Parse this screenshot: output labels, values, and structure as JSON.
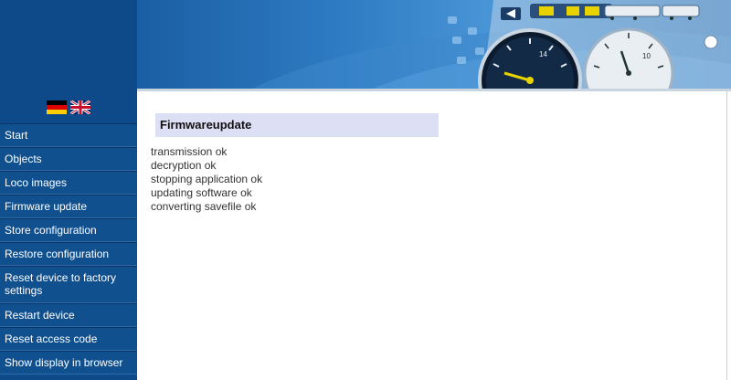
{
  "languages": [
    {
      "code": "de",
      "icon": "german-flag-icon"
    },
    {
      "code": "en",
      "icon": "uk-flag-icon"
    }
  ],
  "sidebar": {
    "items": [
      {
        "label": "Start"
      },
      {
        "label": "Objects"
      },
      {
        "label": "Loco images"
      },
      {
        "label": "Firmware update"
      },
      {
        "label": "Store configuration"
      },
      {
        "label": "Restore configuration"
      },
      {
        "label": "Reset device to factory settings"
      },
      {
        "label": "Restart device"
      },
      {
        "label": "Reset access code"
      },
      {
        "label": "Show display in browser"
      }
    ]
  },
  "main": {
    "title": "Firmwareupdate",
    "log": [
      "transmission ok",
      "decryption ok",
      "stopping application ok",
      "updating software ok",
      "converting savefile ok"
    ]
  },
  "banner": {
    "gauge_left_label": "14",
    "gauge_right_label": "10"
  },
  "colors": {
    "sidebar": "#0e4a8a",
    "title_bg": "#dde0f4",
    "banner": "#2f7cc4"
  }
}
